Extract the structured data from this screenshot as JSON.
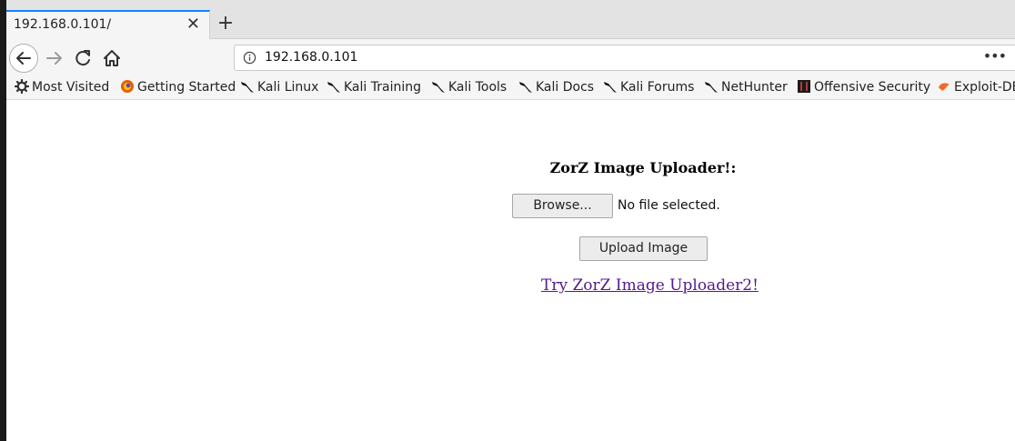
{
  "tab": {
    "title": "192.168.0.101/",
    "close_glyph": "✕"
  },
  "newtab": {
    "glyph": "+"
  },
  "address": {
    "url": "192.168.0.101",
    "more_glyph": "•••"
  },
  "bookmarks": [
    {
      "label": "Most Visited",
      "icon": "gear-icon"
    },
    {
      "label": "Getting Started",
      "icon": "firefox-icon"
    },
    {
      "label": "Kali Linux",
      "icon": "kali-dragon-icon"
    },
    {
      "label": "Kali Training",
      "icon": "kali-dragon-icon"
    },
    {
      "label": "Kali Tools",
      "icon": "kali-dragon-icon"
    },
    {
      "label": "Kali Docs",
      "icon": "kali-dragon-icon"
    },
    {
      "label": "Kali Forums",
      "icon": "kali-dragon-icon"
    },
    {
      "label": "NetHunter",
      "icon": "kali-dragon-icon"
    },
    {
      "label": "Offensive Security",
      "icon": "offsec-icon"
    },
    {
      "label": "Exploit-DB",
      "icon": "exploit-db-icon"
    }
  ],
  "page": {
    "heading": "ZorZ Image Uploader!:",
    "browse_label": "Browse...",
    "file_status": "No file selected.",
    "upload_label": "Upload Image",
    "link_text": "Try ZorZ Image Uploader2!"
  },
  "colors": {
    "tab_accent": "#0a84ff",
    "visited_link": "#551a8b"
  }
}
